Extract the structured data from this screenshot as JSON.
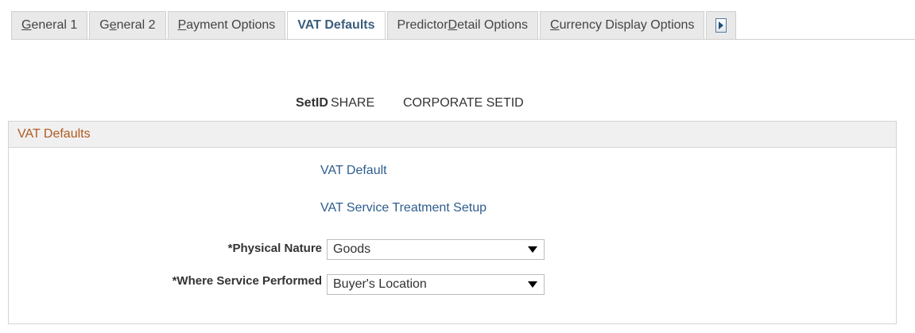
{
  "tabs": [
    {
      "pre": "",
      "acc": "G",
      "post": "eneral 1",
      "active": false
    },
    {
      "pre": "G",
      "acc": "e",
      "post": "neral 2",
      "active": false
    },
    {
      "pre": "",
      "acc": "P",
      "post": "ayment Options",
      "active": false
    },
    {
      "pre": "VAT Defaults",
      "acc": "",
      "post": "",
      "active": true
    },
    {
      "pre": "Predictor ",
      "acc": "D",
      "post": "etail Options",
      "active": false
    },
    {
      "pre": "",
      "acc": "C",
      "post": "urrency Display Options",
      "active": false
    }
  ],
  "tab_scroll_icon": "scroll-right-icon",
  "setid": {
    "label": "SetID",
    "value": "SHARE",
    "description": "CORPORATE SETID"
  },
  "group": {
    "title": "VAT Defaults"
  },
  "links": {
    "vat_default": "VAT Default",
    "vat_service": "VAT Service Treatment Setup"
  },
  "fields": {
    "physical_nature": {
      "label": "*Physical Nature",
      "value": "Goods"
    },
    "where_service": {
      "label": "*Where Service Performed",
      "value": "Buyer's Location"
    }
  },
  "colors": {
    "group_title": "#b05a1e",
    "link": "#2e5d8e"
  }
}
